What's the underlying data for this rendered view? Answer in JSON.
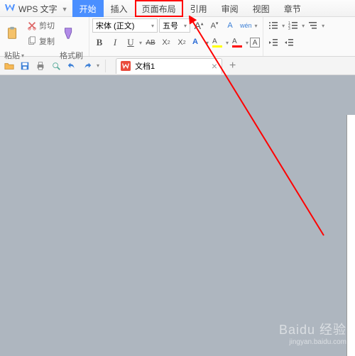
{
  "app": {
    "title": "WPS 文字"
  },
  "tabs": {
    "items": [
      "开始",
      "插入",
      "页面布局",
      "引用",
      "审阅",
      "视图",
      "章节"
    ],
    "activeIndex": 0,
    "highlightedIndex": 2
  },
  "ribbon": {
    "clipboard": {
      "cut": "剪切",
      "copy": "复制",
      "paste": "粘贴",
      "format_painter": "格式刷"
    },
    "font": {
      "name": "宋体 (正文)",
      "size": "五号",
      "bold": "B",
      "italic": "I",
      "underline": "U",
      "strike": "AB",
      "superscript": "X²",
      "subscript": "X₂",
      "grow": "A",
      "shrink": "A",
      "clear_format": "A",
      "pinyin": "wén",
      "highlight_color": "#ffff00",
      "font_color": "#ff0000",
      "text_effect_color": "#2a6bd6",
      "char_border": "A"
    },
    "paragraph": {
      "bullets": "•",
      "numbering": "1",
      "multilevel": "Ⅰ",
      "decrease_indent": "«",
      "increase_indent": "»"
    }
  },
  "qat": {
    "items": [
      "open",
      "save",
      "print",
      "preview",
      "undo",
      "redo"
    ]
  },
  "doc_tabs": {
    "items": [
      {
        "name": "文档1"
      }
    ],
    "new_tab": "+"
  },
  "watermark": {
    "brand": "Baidu 经验",
    "url": "jingyan.baidu.com"
  }
}
